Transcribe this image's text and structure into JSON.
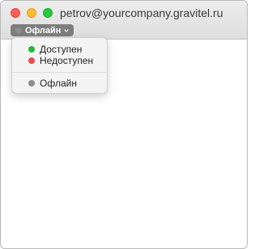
{
  "window": {
    "title": "petrov@yourcompany.gravitel.ru"
  },
  "status_button": {
    "label": "Офлайн",
    "dot_color": "#8e8e8e",
    "icon": "chevron-down-icon"
  },
  "status_menu": {
    "items": [
      {
        "label": "Доступен",
        "dot_color": "#28b83e"
      },
      {
        "label": "Недоступен",
        "dot_color": "#f44747"
      },
      {
        "label": "Офлайн",
        "dot_color": "#8c8c8c"
      }
    ]
  }
}
